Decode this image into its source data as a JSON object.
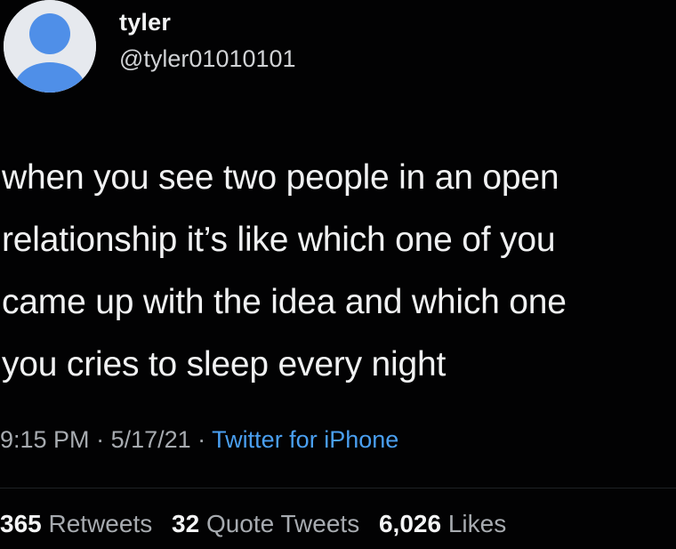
{
  "user": {
    "display_name": "tyler",
    "handle": "@tyler01010101",
    "avatar_icon": "default-avatar-icon",
    "avatar_colors": {
      "background": "#e6e9ee",
      "figure": "#4f8fe8"
    }
  },
  "tweet": {
    "lines": [
      "when you see two people in an open",
      "relationship it’s like which one of you",
      "came up with the idea and which one",
      "you cries to sleep every night"
    ]
  },
  "meta": {
    "time": "9:15 PM",
    "separator": " · ",
    "date": "5/17/21",
    "source": "Twitter for iPhone",
    "source_color": "#4a9ff0"
  },
  "stats": {
    "retweets": {
      "count": "365",
      "label": "Retweets"
    },
    "quotes": {
      "count": "32",
      "label": "Quote Tweets"
    },
    "likes": {
      "count": "6,026",
      "label": "Likes"
    }
  }
}
